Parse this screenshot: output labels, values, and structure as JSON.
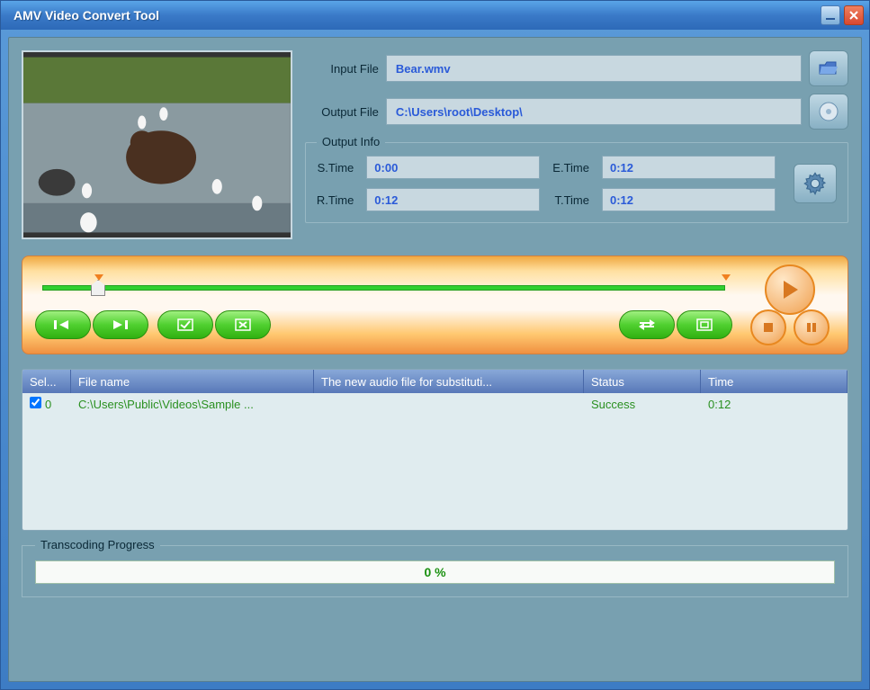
{
  "window": {
    "title": "AMV Video Convert Tool"
  },
  "files": {
    "input_label": "Input File",
    "input_value": "Bear.wmv",
    "output_label": "Output File",
    "output_value": "C:\\Users\\root\\Desktop\\"
  },
  "output_info": {
    "legend": "Output Info",
    "s_time_label": "S.Time",
    "s_time": "0:00",
    "e_time_label": "E.Time",
    "e_time": "0:12",
    "r_time_label": "R.Time",
    "r_time": "0:12",
    "t_time_label": "T.Time",
    "t_time": "0:12"
  },
  "player": {
    "icons": {
      "mark_in": "mark-in-icon",
      "mark_out": "mark-out-icon",
      "check": "check-icon",
      "cancel": "cancel-icon",
      "convert": "convert-icon",
      "fullscreen": "fullscreen-icon",
      "play": "play-icon",
      "stop": "stop-icon",
      "pause": "pause-icon"
    }
  },
  "table": {
    "headers": {
      "select": "Sel...",
      "filename": "File name",
      "audio": "The new audio file for substituti...",
      "status": "Status",
      "time": "Time"
    },
    "rows": [
      {
        "checked": true,
        "index": "0",
        "filename": "C:\\Users\\Public\\Videos\\Sample ...",
        "audio": "",
        "status": "Success",
        "time": "0:12"
      }
    ]
  },
  "progress": {
    "legend": "Transcoding Progress",
    "text": "0 %"
  }
}
